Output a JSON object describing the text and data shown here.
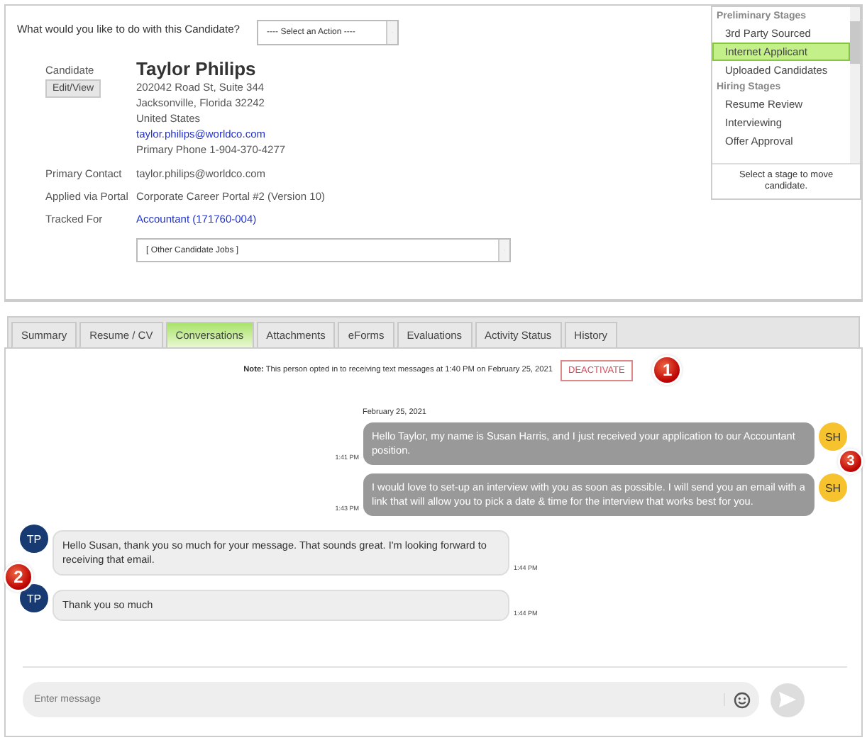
{
  "action_prompt": {
    "question": "What would you like to do with this Candidate?",
    "select": "---- Select an Action ----"
  },
  "candidate": {
    "label": "Candidate",
    "edit_button": "Edit/View",
    "name": "Taylor Philips",
    "address": [
      "202042 Road St, Suite 344",
      "Jacksonville, Florida  32242",
      "United States"
    ],
    "email": "taylor.philips@worldco.com",
    "phone": "Primary Phone 1-904-370-4277"
  },
  "fields": [
    {
      "label": "Primary Contact",
      "value": "taylor.philips@worldco.com",
      "kind": "text"
    },
    {
      "label": "Applied via Portal",
      "value": "Corporate Career Portal #2 (Version 10)",
      "kind": "text"
    },
    {
      "label": "Tracked For",
      "value": "Accountant (171760-004)",
      "kind": "link"
    }
  ],
  "other_jobs_select": "[ Other Candidate Jobs ]",
  "stages": {
    "groups": [
      {
        "title": "Preliminary Stages",
        "items": [
          {
            "label": "3rd Party Sourced",
            "selected": false
          },
          {
            "label": "Internet Applicant",
            "selected": true
          },
          {
            "label": "Uploaded Candidates",
            "selected": false
          }
        ]
      },
      {
        "title": "Hiring Stages",
        "items": [
          {
            "label": "Resume Review",
            "selected": false
          },
          {
            "label": "Interviewing",
            "selected": false
          },
          {
            "label": "Offer Approval",
            "selected": false
          }
        ]
      }
    ],
    "hint": "Select a stage to move candidate."
  },
  "tabs": [
    {
      "label": "Summary",
      "selected": false
    },
    {
      "label": "Resume / CV",
      "selected": false
    },
    {
      "label": "Conversations",
      "selected": true
    },
    {
      "label": "Attachments",
      "selected": false
    },
    {
      "label": "eForms",
      "selected": false
    },
    {
      "label": "Evaluations",
      "selected": false
    },
    {
      "label": "Activity Status",
      "selected": false
    },
    {
      "label": "History",
      "selected": false
    }
  ],
  "note": {
    "text": "**Note:** This person opted in to receiving text messages at 1:40 PM on February 25, 2021",
    "button": "DEACTIVATE",
    "callout": "1"
  },
  "date": "February 25, 2021",
  "messages": [
    {
      "kind": "outgoing",
      "initials": "SH",
      "text": "Hello Taylor, my name is Susan Harris, and I just received your application to our Accountant position.",
      "time": "1:41 PM",
      "callout": "3"
    },
    {
      "kind": "outgoing",
      "initials": "SH",
      "text": "I would love to set-up an interview with you as soon as possible. I will send you an email with a link that will allow you to pick a date & time for the interview that works best for you.",
      "time": "1:43 PM"
    },
    {
      "kind": "incoming",
      "initials": "TP",
      "text": "Hello Susan, thank you so much for your message. That sounds great. I'm looking forward to receiving that email.",
      "time": "1:44 PM",
      "callout": "2"
    },
    {
      "kind": "incoming",
      "initials": "TP",
      "text": "Thank you so much",
      "time": "1:44 PM"
    }
  ],
  "composer": {
    "placeholder": "Enter message"
  }
}
